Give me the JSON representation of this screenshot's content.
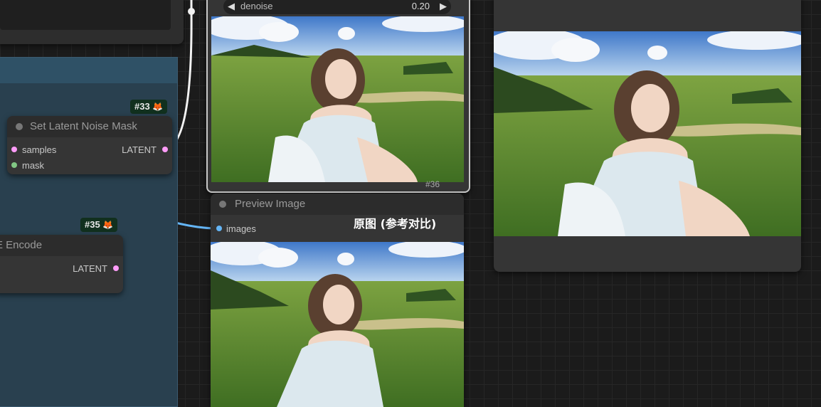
{
  "nodes": {
    "set_latent_noise_mask": {
      "title": "Set Latent Noise Mask",
      "badge": "#33",
      "inputs": [
        "samples",
        "mask"
      ],
      "output": "LATENT"
    },
    "vae_encode": {
      "title": "E Encode",
      "badge": "#35",
      "output": "LATENT"
    },
    "ksampler": {
      "widget_label": "denoise",
      "widget_value": "0.20",
      "badge": "#36"
    },
    "preview_image": {
      "title": "Preview Image",
      "input": "images"
    }
  },
  "annotation": "原图 (参考对比)",
  "icons": [
    "fox-icon",
    "chevron-left-icon",
    "chevron-right-icon",
    "status-dot-icon"
  ],
  "colors": {
    "latent_link": "#ff9cf9",
    "image_link": "#64b5f6",
    "mask_link": "#81c784",
    "group_bg": "#29404f"
  }
}
